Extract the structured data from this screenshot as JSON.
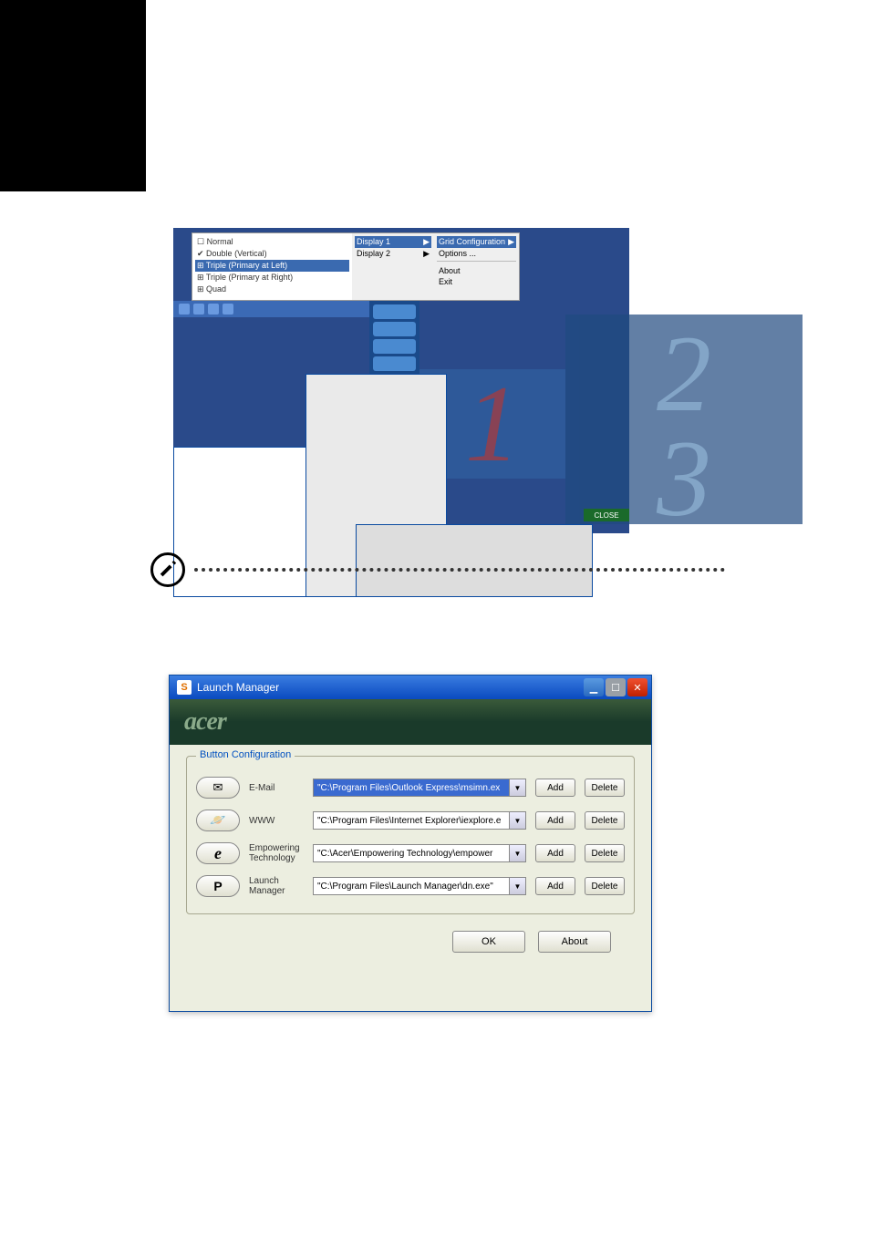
{
  "gridvista": {
    "menu_left": {
      "normal": "Normal",
      "double": "Double (Vertical)",
      "triple_left": "Triple (Primary at Left)",
      "triple_right": "Triple (Primary at Right)",
      "quad": "Quad"
    },
    "menu_mid": {
      "display1": "Display 1",
      "display2": "Display 2"
    },
    "menu_right": {
      "gridconfig": "Grid Configuration",
      "options": "Options ...",
      "about": "About",
      "exit": "Exit"
    },
    "tiles": {
      "one": "1",
      "two": "2",
      "three": "3"
    },
    "tag": "CLOSE"
  },
  "launch_manager": {
    "title": "Launch Manager",
    "brand": "acer",
    "section_label": "Button Configuration",
    "rows": [
      {
        "key": "email",
        "label": "E-Mail",
        "path": "\"C:\\Program Files\\Outlook Express\\msimn.ex",
        "add": "Add",
        "delete": "Delete"
      },
      {
        "key": "www",
        "label": "WWW",
        "path": "\"C:\\Program Files\\Internet Explorer\\iexplore.e",
        "add": "Add",
        "delete": "Delete"
      },
      {
        "key": "empowering",
        "label": "Empowering Technology",
        "path": "\"C:\\Acer\\Empowering Technology\\empower",
        "add": "Add",
        "delete": "Delete"
      },
      {
        "key": "launchmgr",
        "label": "Launch Manager",
        "path": "\"C:\\Program Files\\Launch Manager\\dn.exe\"",
        "add": "Add",
        "delete": "Delete"
      }
    ],
    "ok": "OK",
    "about": "About"
  },
  "menu_arrows": {
    "right": "▶"
  }
}
